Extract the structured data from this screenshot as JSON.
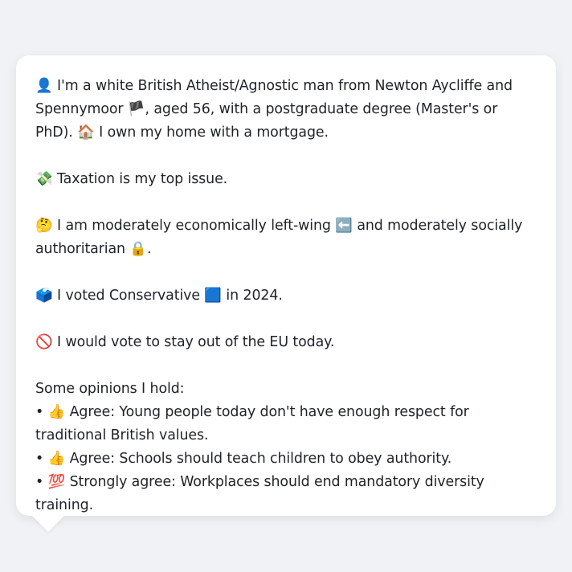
{
  "profile": {
    "intro": {
      "icon": "👤",
      "text_a": "I'm a white British Atheist/Agnostic man from Newton Aycliffe and Spennymoor",
      "flag": "🏴",
      "text_b": ", aged 56, with a postgraduate degree (Master's or PhD).",
      "home_icon": "🏠",
      "text_c": "I own my home with a mortgage."
    },
    "top_issue": {
      "icon": "💸",
      "text": "Taxation is my top issue."
    },
    "position": {
      "icon": "🤔",
      "text_a": "I am moderately economically left-wing",
      "left_icon": "⬅️",
      "text_b": "and moderately socially authoritarian",
      "lock_icon": "🔒",
      "text_c": "."
    },
    "vote": {
      "icon": "🗳️",
      "text_a": "I voted Conservative",
      "party_icon": "🟦",
      "text_b": "in 2024."
    },
    "eu": {
      "icon": "🚫",
      "text": "I would vote to stay out of the EU today."
    },
    "opinions": {
      "heading": "Some opinions I hold:",
      "items": [
        {
          "bullet": "•",
          "icon": "👍",
          "text": "Agree: Young people today don't have enough respect for traditional British values."
        },
        {
          "bullet": "•",
          "icon": "👍",
          "text": "Agree: Schools should teach children to obey authority."
        },
        {
          "bullet": "•",
          "icon": "💯",
          "text": "Strongly agree: Workplaces should end mandatory diversity training."
        }
      ]
    }
  },
  "colors": {
    "page_background": "#f0f2f5",
    "card_background": "#ffffff",
    "text": "#1f2328"
  }
}
